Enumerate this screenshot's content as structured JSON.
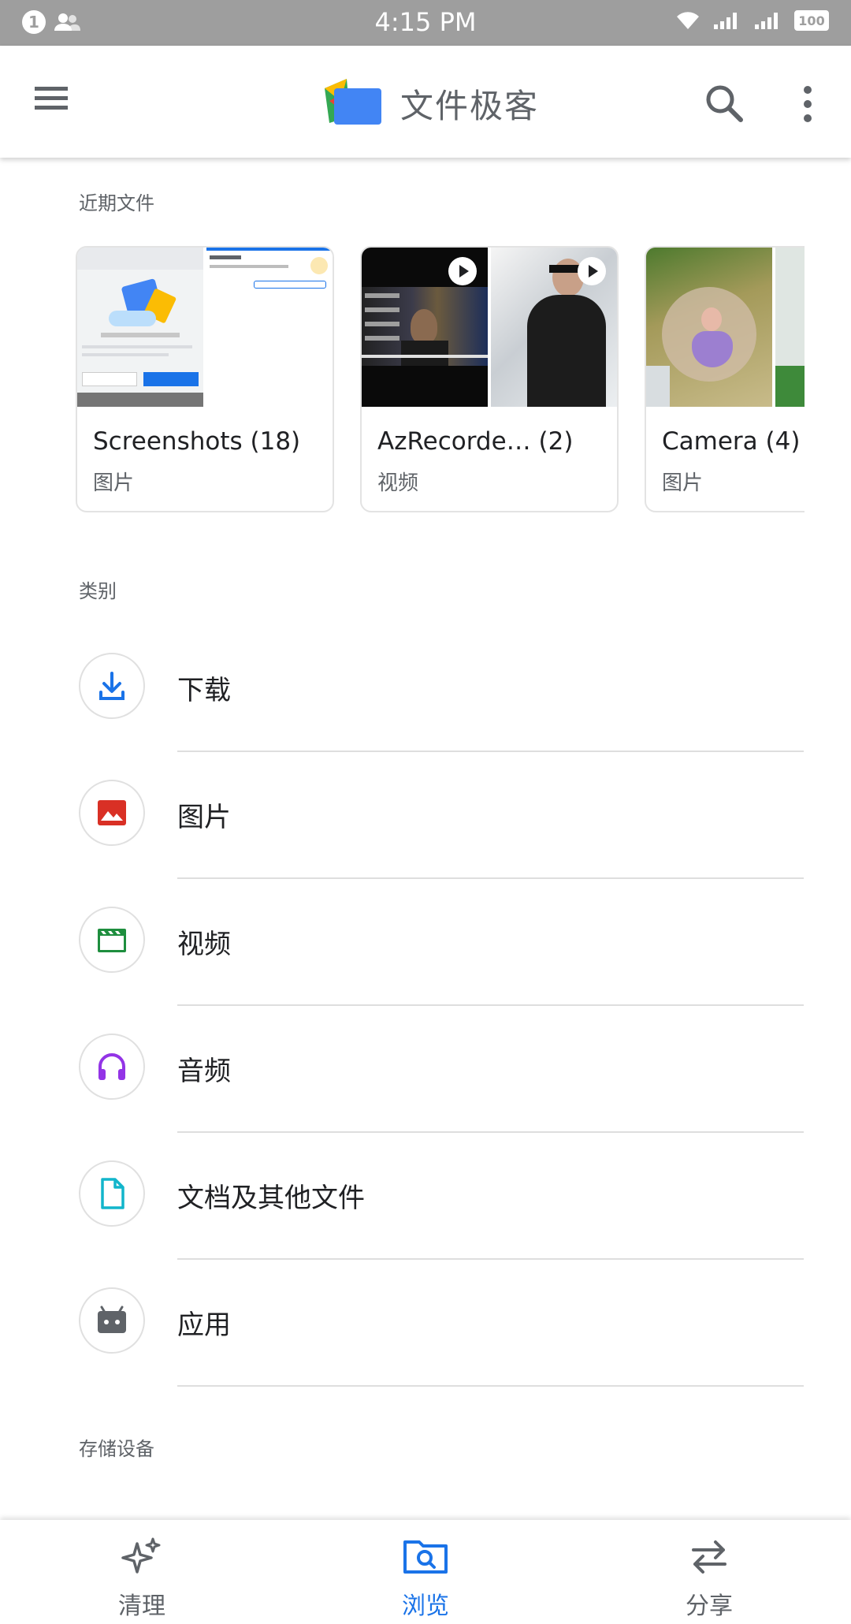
{
  "status_bar": {
    "notification_count": "1",
    "time": "4:15 PM",
    "battery": "100"
  },
  "app_bar": {
    "title": "文件极客"
  },
  "recent": {
    "section_label": "近期文件",
    "cards": [
      {
        "name": "Screenshots (18)",
        "type": "图片"
      },
      {
        "name": "AzRecorde… (2)",
        "type": "视频"
      },
      {
        "name": "Camera (4)",
        "type": "图片"
      }
    ]
  },
  "categories": {
    "section_label": "类别",
    "items": [
      {
        "label": "下载",
        "icon": "download-icon",
        "color": "#1a73e8"
      },
      {
        "label": "图片",
        "icon": "image-icon",
        "color": "#d93025"
      },
      {
        "label": "视频",
        "icon": "video-icon",
        "color": "#1e8e3e"
      },
      {
        "label": "音频",
        "icon": "headphones-icon",
        "color": "#9334e6"
      },
      {
        "label": "文档及其他文件",
        "icon": "document-icon",
        "color": "#12b5cb"
      },
      {
        "label": "应用",
        "icon": "android-icon",
        "color": "#5f6368"
      }
    ]
  },
  "storage": {
    "section_label": "存储设备"
  },
  "bottom_nav": {
    "items": [
      {
        "label": "清理",
        "icon": "sparkle-icon"
      },
      {
        "label": "浏览",
        "icon": "browse-folder-icon",
        "active": true
      },
      {
        "label": "分享",
        "icon": "swap-arrows-icon"
      }
    ],
    "active_color": "#1a73e8"
  }
}
